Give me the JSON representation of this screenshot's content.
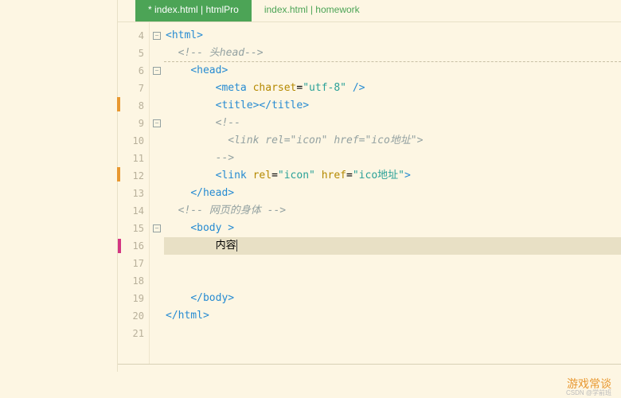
{
  "tabs": [
    {
      "label": "* index.html | htmlPro",
      "active": true
    },
    {
      "label": "index.html | homework",
      "active": false
    }
  ],
  "lines": {
    "start": 4,
    "end": 21,
    "fold": {
      "4": true,
      "6": true,
      "9": true,
      "15": true
    },
    "marks": [
      8,
      12
    ],
    "highlight": 16
  },
  "code": {
    "l4": {
      "open": "<",
      "tag": "html",
      "close": ">"
    },
    "l5": {
      "comment": "<!-- 头head-->"
    },
    "l6": {
      "open": "<",
      "tag": "head",
      "close": ">"
    },
    "l7": {
      "open": "<",
      "tag": "meta",
      "sp": " ",
      "attr": "charset",
      "eq": "=",
      "val": "\"utf-8\"",
      "close": " />"
    },
    "l8": {
      "open": "<",
      "tag": "title",
      "midclose": ">",
      "open2": "</",
      "tag2": "title",
      "close": ">"
    },
    "l9": {
      "comment": "<!--"
    },
    "l10": {
      "comment": "<link rel=\"icon\" href=\"ico地址\">"
    },
    "l11": {
      "comment": "-->"
    },
    "l12": {
      "open": "<",
      "tag": "link",
      "sp": " ",
      "attr1": "rel",
      "eq": "=",
      "val1": "\"icon\"",
      "sp2": " ",
      "attr2": "href",
      "eq2": "=",
      "val2": "\"ico地址\"",
      "close": ">"
    },
    "l13": {
      "open": "</",
      "tag": "head",
      "close": ">"
    },
    "l14": {
      "comment": "<!-- 网页的身体 -->"
    },
    "l15": {
      "open": "<",
      "tag": "body ",
      "close": ">"
    },
    "l16": {
      "text": "内容"
    },
    "l19": {
      "open": "</",
      "tag": "body",
      "close": ">"
    },
    "l20": {
      "open": "</",
      "tag": "html",
      "close": ">"
    }
  },
  "watermark": "游戏常谈",
  "watermark_sub": "CSDN @学前班"
}
